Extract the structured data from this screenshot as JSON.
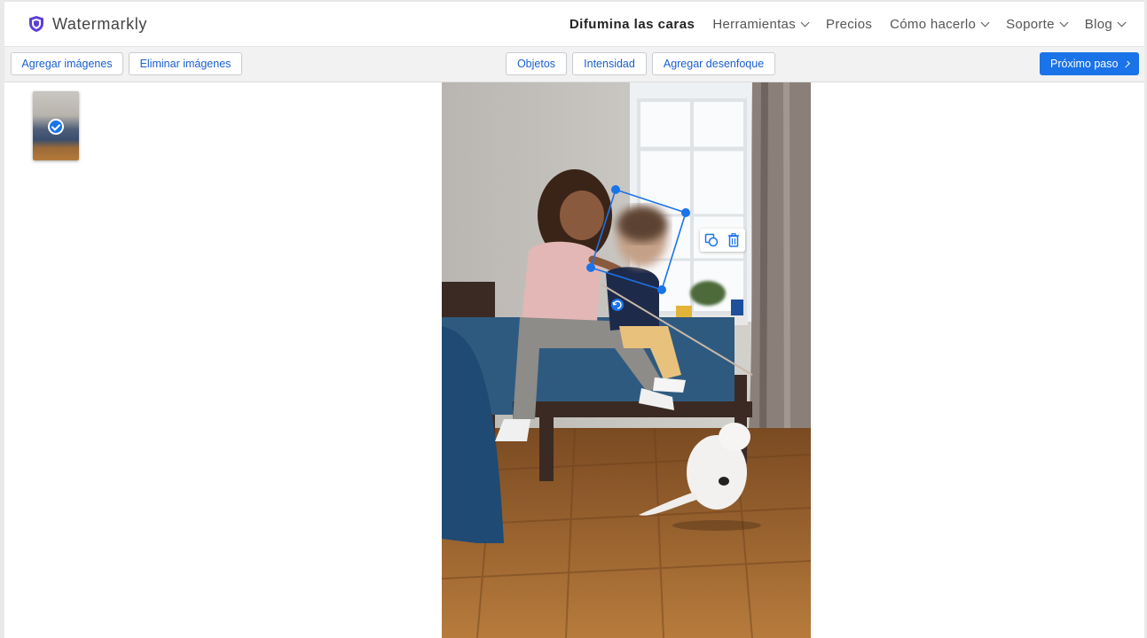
{
  "brand": {
    "name": "Watermarkly",
    "logo_icon": "shield-icon",
    "accent": "#5b3fd6"
  },
  "nav": {
    "items": [
      {
        "label": "Difumina las caras",
        "active": true,
        "dropdown": false
      },
      {
        "label": "Herramientas",
        "active": false,
        "dropdown": true
      },
      {
        "label": "Precios",
        "active": false,
        "dropdown": false
      },
      {
        "label": "Cómo hacerlo",
        "active": false,
        "dropdown": true
      },
      {
        "label": "Soporte",
        "active": false,
        "dropdown": true
      },
      {
        "label": "Blog",
        "active": false,
        "dropdown": true
      }
    ]
  },
  "toolbar": {
    "add_images": "Agregar imágenes",
    "remove_images": "Eliminar imágenes",
    "objects": "Objetos",
    "intensity": "Intensidad",
    "add_blur": "Agregar desenfoque",
    "next_step": "Próximo paso",
    "accent": "#1a73e8"
  },
  "thumbnails": [
    {
      "selected": true
    }
  ],
  "canvas": {
    "blur_region_tools": [
      "duplicate-icon",
      "trash-icon"
    ],
    "rotate_handle_icon": "rotate-icon",
    "selection_color": "#1a73e8"
  }
}
